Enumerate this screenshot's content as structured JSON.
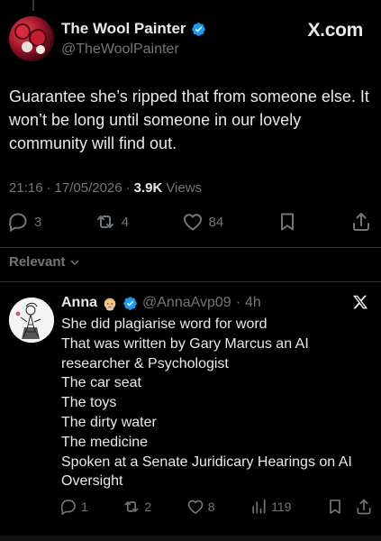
{
  "main_tweet": {
    "author_name": "The Wool Painter",
    "handle": "@TheWoolPainter",
    "brand": "X.com",
    "text": "Guarantee she’s ripped that from someone else. It won’t be long until someone in our lovely community will find out.",
    "time": "21:16",
    "date": "17/05/2026",
    "views_count": "3.9K",
    "views_label": "Views",
    "replies": "3",
    "reposts": "4",
    "likes": "84"
  },
  "sort": {
    "label": "Relevant"
  },
  "reply": {
    "author_name": "Anna",
    "handle": "@AnnaAvp09",
    "age": "4h",
    "lines": [
      "She did plagiarise word for word",
      "That was written by Gary Marcus an AI",
      "researcher & Psychologist",
      "The car seat",
      "The toys",
      "The dirty water",
      "The medicine",
      "Spoken at a Senate Juridicary Hearings on AI",
      "Oversight"
    ],
    "replies": "1",
    "reposts": "2",
    "likes": "8",
    "views": "119"
  },
  "colors": {
    "background": "#000000",
    "text_primary": "#e7e9ea",
    "text_secondary": "#71767b",
    "verified_blue": "#1d9bf0",
    "divider": "#2f3336"
  },
  "icons": {
    "verified": "verified-badge-icon",
    "reply": "reply-icon",
    "repost": "repost-icon",
    "like": "heart-icon",
    "bookmark": "bookmark-icon",
    "share": "share-icon",
    "views": "views-bar-icon",
    "x_logo": "x-logo-icon",
    "chevron": "chevron-down-icon"
  }
}
